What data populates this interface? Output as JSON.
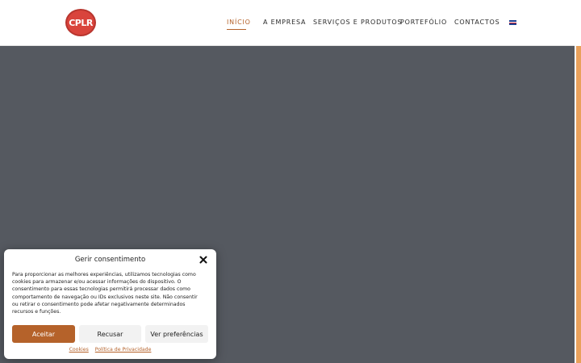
{
  "logo": {
    "text": "CPLR"
  },
  "nav": {
    "items": [
      {
        "label": "INÍCIO",
        "active": true
      },
      {
        "label": "A EMPRESA",
        "active": false
      },
      {
        "label": "SERVIÇOS E PRODUTOS",
        "active": false
      },
      {
        "label": "PORTEFÓLIO",
        "active": false
      },
      {
        "label": "CONTACTOS",
        "active": false
      }
    ],
    "language_icon": "uk-flag-icon"
  },
  "consent": {
    "title": "Gerir consentimento",
    "body": "Para proporcionar as melhores experiências, utilizamos tecnologias como cookies para armazenar e/ou acessar informações do dispositivo. O consentimento para essas tecnologias permitirá processar dados como comportamento de navegação ou IDs exclusivos neste site. Não consentir ou retirar o consentimento pode afetar negativamente determinados recursos e funções.",
    "accept_label": "Aceitar",
    "deny_label": "Recusar",
    "prefs_label": "Ver preferências",
    "links": {
      "cookies": "Cookies",
      "privacy": "Política de Privacidade"
    }
  },
  "colors": {
    "accent": "#b5622a",
    "hero_bg": "#555960",
    "logo_red": "#d9443c"
  }
}
